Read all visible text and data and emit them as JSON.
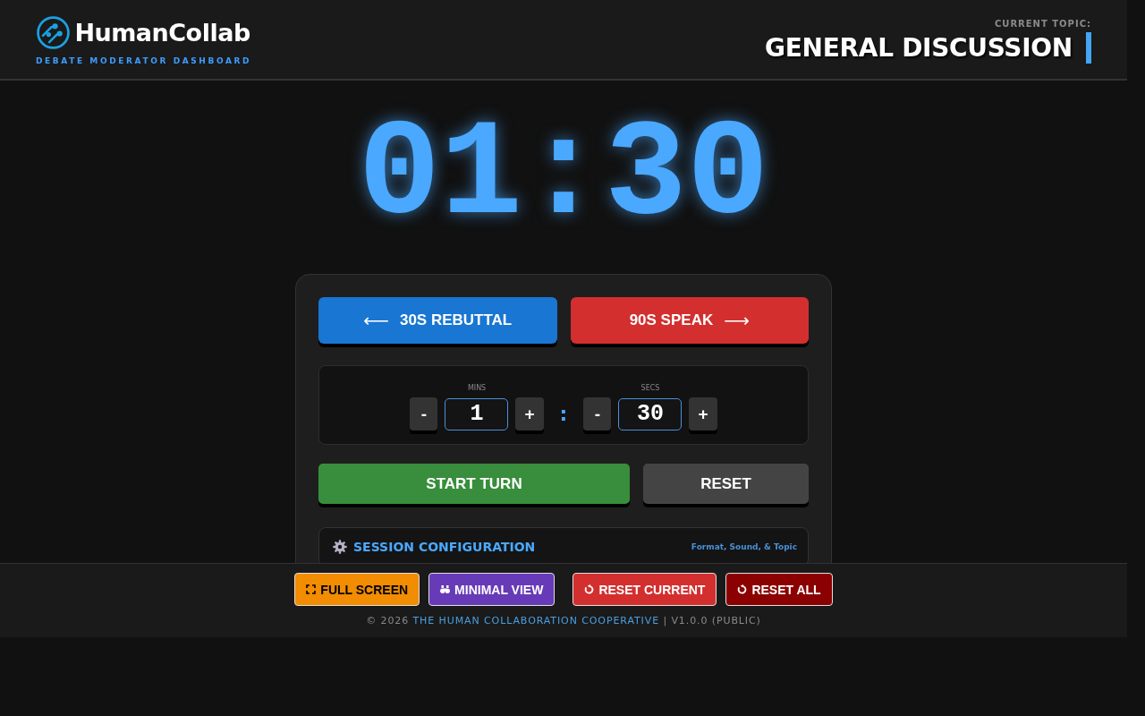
{
  "header": {
    "brand": "HumanCollab",
    "subtitle": "DEBATE MODERATOR DASHBOARD",
    "topic_label": "CURRENT TOPIC:",
    "topic": "GENERAL DISCUSSION"
  },
  "timer": {
    "display": "01:30"
  },
  "turn_buttons": [
    {
      "kind": "back",
      "arrow": "⟵",
      "label": "30S REBUTTAL"
    },
    {
      "kind": "forward",
      "arrow": "⟶",
      "label": "90S SPEAK"
    }
  ],
  "time_setter": {
    "separator": ":",
    "fields": [
      {
        "label": "MINS",
        "decrement": "-",
        "value": "1",
        "increment": "+"
      },
      {
        "label": "SECS",
        "decrement": "-",
        "value": "30",
        "increment": "+"
      }
    ]
  },
  "actions": [
    {
      "kind": "primary",
      "label": "START TURN"
    },
    {
      "kind": "secondary",
      "label": "RESET"
    }
  ],
  "session_config": {
    "title": "SESSION CONFIGURATION",
    "hint": "Format, Sound, & Topic"
  },
  "footer": {
    "view_buttons": [
      {
        "kind": "fullscreen",
        "label": "FULL SCREEN"
      },
      {
        "kind": "minimal",
        "label": "MINIMAL VIEW"
      }
    ],
    "reset_buttons": [
      {
        "kind": "reset-current",
        "label": "RESET CURRENT"
      },
      {
        "kind": "reset-all",
        "label": "RESET ALL"
      }
    ],
    "copyright": {
      "prefix": "© 2026",
      "link": "THE HUMAN COLLABORATION COOPERATIVE",
      "suffix": "| V1.0.0 (PUBLIC)"
    }
  }
}
